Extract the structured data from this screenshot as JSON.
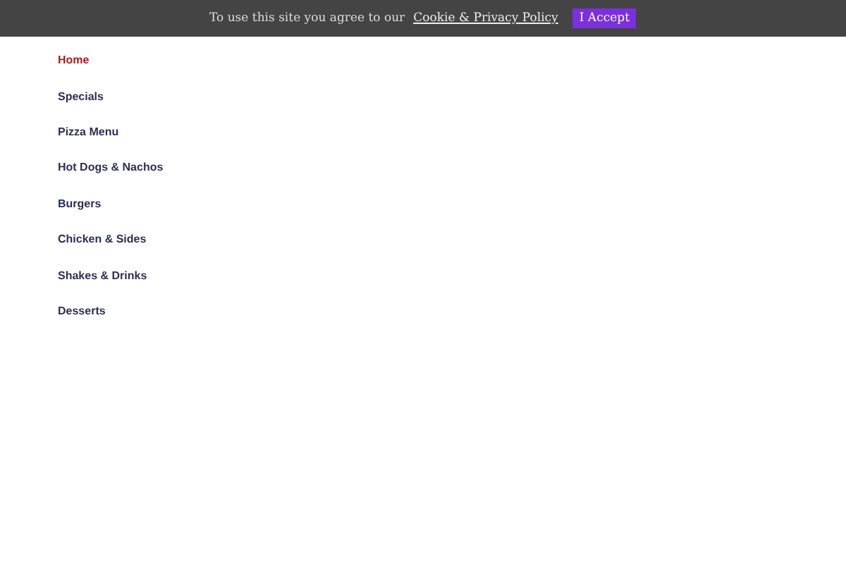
{
  "cookie_banner": {
    "message": "To use this site you agree to our",
    "link": "Cookie & Privacy Policy",
    "button": "I Accept"
  },
  "menu": [
    {
      "label": "Home",
      "selected": true
    },
    {
      "label": "Specials",
      "selected": false
    },
    {
      "label": "Pizza Menu",
      "selected": false
    },
    {
      "label": "Hot Dogs & Nachos",
      "selected": false
    },
    {
      "label": "Burgers",
      "selected": false
    },
    {
      "label": "Chicken & Sides",
      "selected": false
    },
    {
      "label": "Shakes & Drinks",
      "selected": false
    },
    {
      "label": "Desserts",
      "selected": false
    }
  ]
}
